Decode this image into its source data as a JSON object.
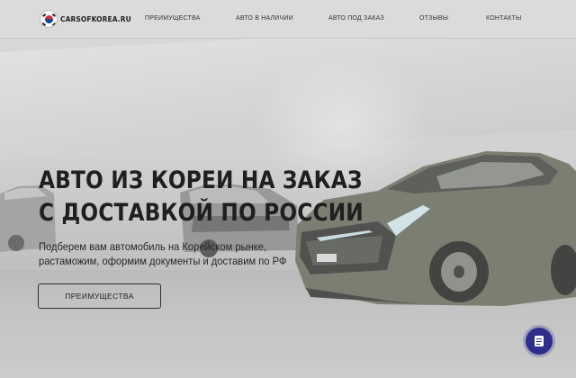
{
  "header": {
    "logo_text": "CARSOFKOREA.RU",
    "nav": [
      {
        "label": "ПРЕИМУЩЕСТВА"
      },
      {
        "label": "АВТО В НАЛИЧИИ"
      },
      {
        "label": "АВТО ПОД ЗАКАЗ"
      },
      {
        "label": "ОТЗЫВЫ"
      },
      {
        "label": "КОНТАКТЫ"
      }
    ]
  },
  "hero": {
    "title_line1": "АВТО ИЗ КОРЕИ НА ЗАКАЗ",
    "title_line2": "С ДОСТАВКОЙ ПО РОССИИ",
    "subtitle_line1": "Подберем вам автомобиль на Корейском рынке,",
    "subtitle_line2": "растаможим, оформим документы и доставим по РФ",
    "cta_label": "ПРЕИМУЩЕСТВА"
  },
  "fab": {
    "icon": "document-icon"
  },
  "colors": {
    "header_bg": "#dcdbdc",
    "fab": "#2d2f8a",
    "text_dark": "#1f1f1f"
  }
}
